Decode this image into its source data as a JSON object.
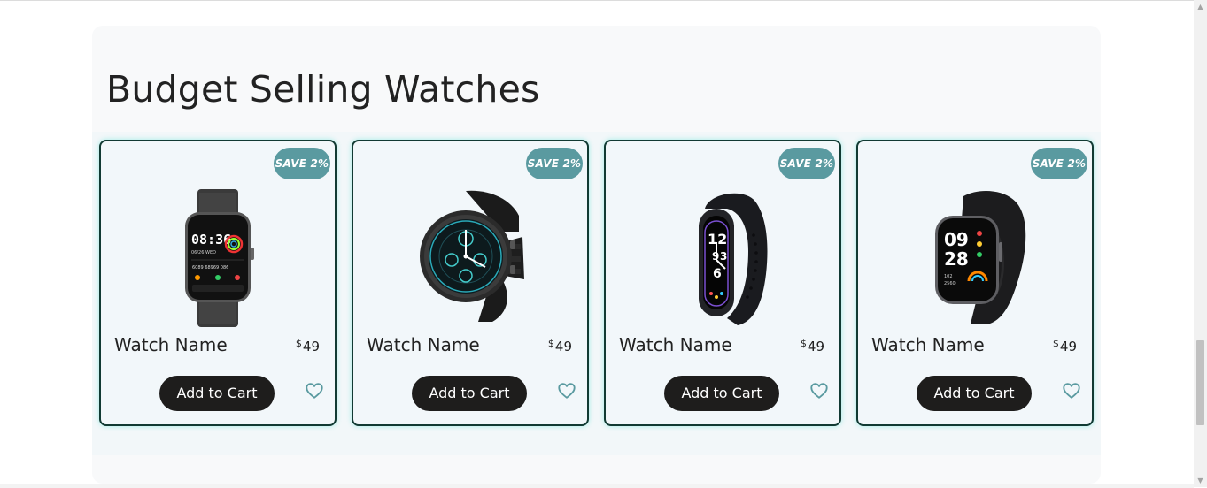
{
  "section": {
    "title": "Budget Selling Watches"
  },
  "products": [
    {
      "badge": "SAVE 2%",
      "name": "Watch Name",
      "currency": "$",
      "price": "49",
      "button": "Add to Cart",
      "image": "square-smartwatch-image"
    },
    {
      "badge": "SAVE 2%",
      "name": "Watch Name",
      "currency": "$",
      "price": "49",
      "button": "Add to Cart",
      "image": "round-smartwatch-image"
    },
    {
      "badge": "SAVE 2%",
      "name": "Watch Name",
      "currency": "$",
      "price": "49",
      "button": "Add to Cart",
      "image": "fitness-band-image"
    },
    {
      "badge": "SAVE 2%",
      "name": "Watch Name",
      "currency": "$",
      "price": "49",
      "button": "Add to Cart",
      "image": "square-smartwatch-dark-image"
    }
  ],
  "icons": {
    "favorite": "heart-icon",
    "scroll_up": "scroll-up-arrow",
    "scroll_down": "scroll-down-arrow"
  },
  "colors": {
    "badge": "#5a9aa0",
    "button": "#1e1d1c",
    "card_border": "#123a33",
    "heart": "#5a9aa0"
  }
}
